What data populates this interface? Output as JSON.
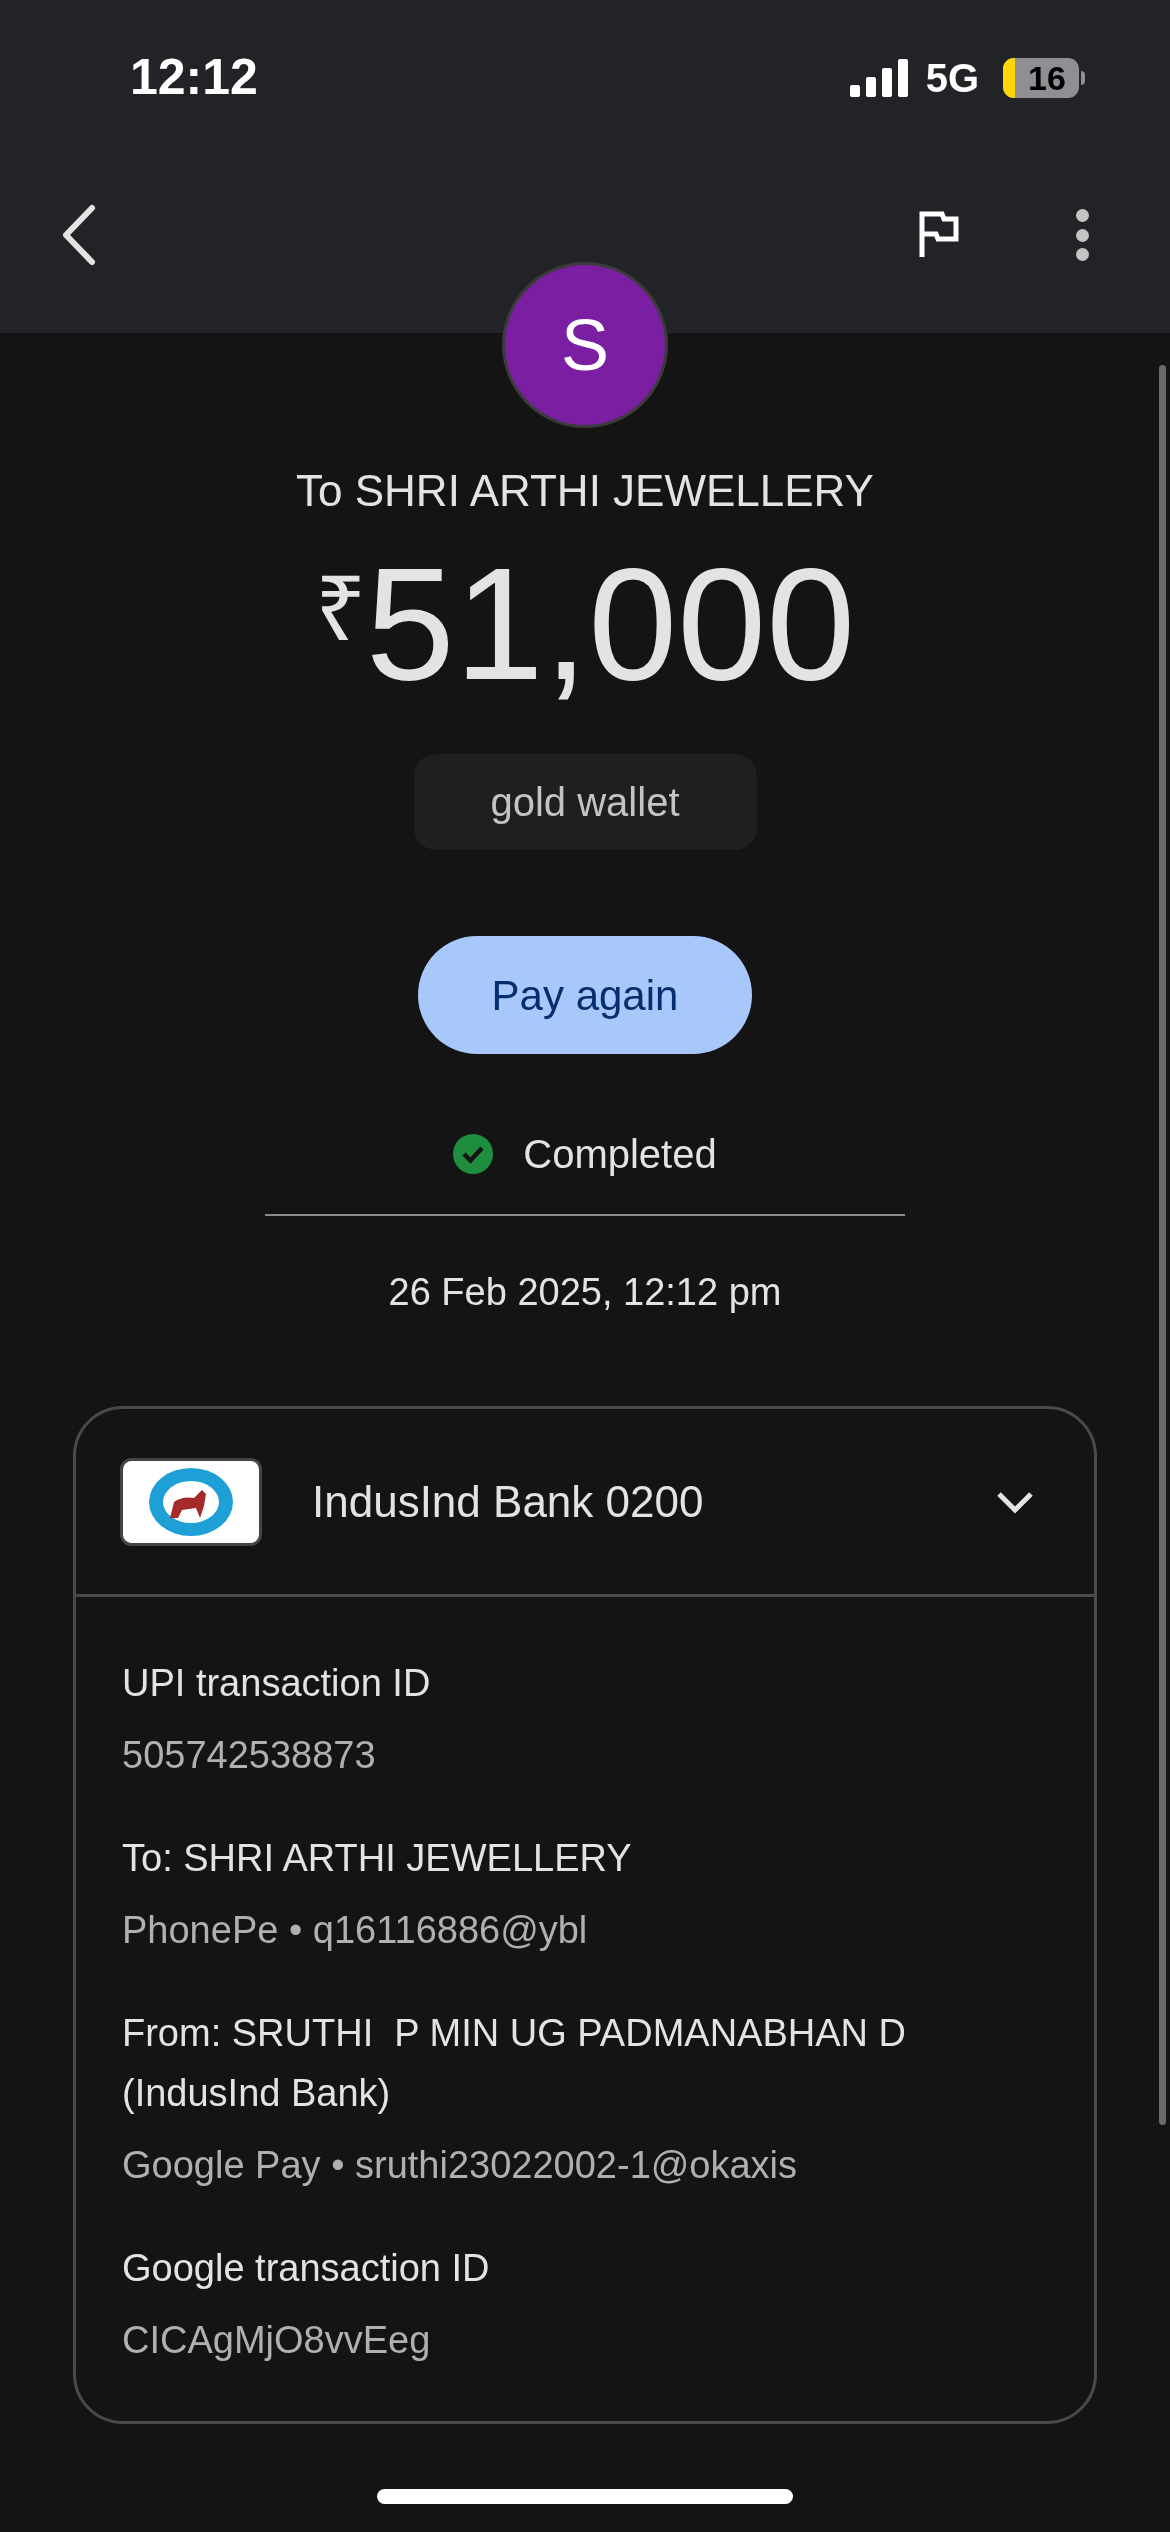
{
  "status_bar": {
    "time": "12:12",
    "network": "5G",
    "battery": "16"
  },
  "avatar": {
    "letter": "S"
  },
  "recipient_title": "To SHRI ARTHI JEWELLERY",
  "amount": {
    "currency": "₹",
    "value": "51,000"
  },
  "note": "gold wallet",
  "pay_again_button": "Pay again",
  "status": {
    "label": "Completed",
    "kind": "success"
  },
  "date": "26 Feb 2025, 12:12 pm",
  "account_card": {
    "bank": "IndusInd Bank 0200",
    "expanded": true,
    "details": [
      {
        "label": "UPI transaction ID",
        "value": "505742538873"
      },
      {
        "label": "To: SHRI ARTHI JEWELLERY",
        "value": "PhonePe • q16116886@ybl"
      },
      {
        "label": "From: SRUTHI  P MIN UG PADMANABHAN D (IndusInd Bank)",
        "value": "Google Pay • sruthi23022002-1@okaxis"
      },
      {
        "label": "Google transaction ID",
        "value": "CICAgMjO8vvEeg"
      }
    ]
  }
}
